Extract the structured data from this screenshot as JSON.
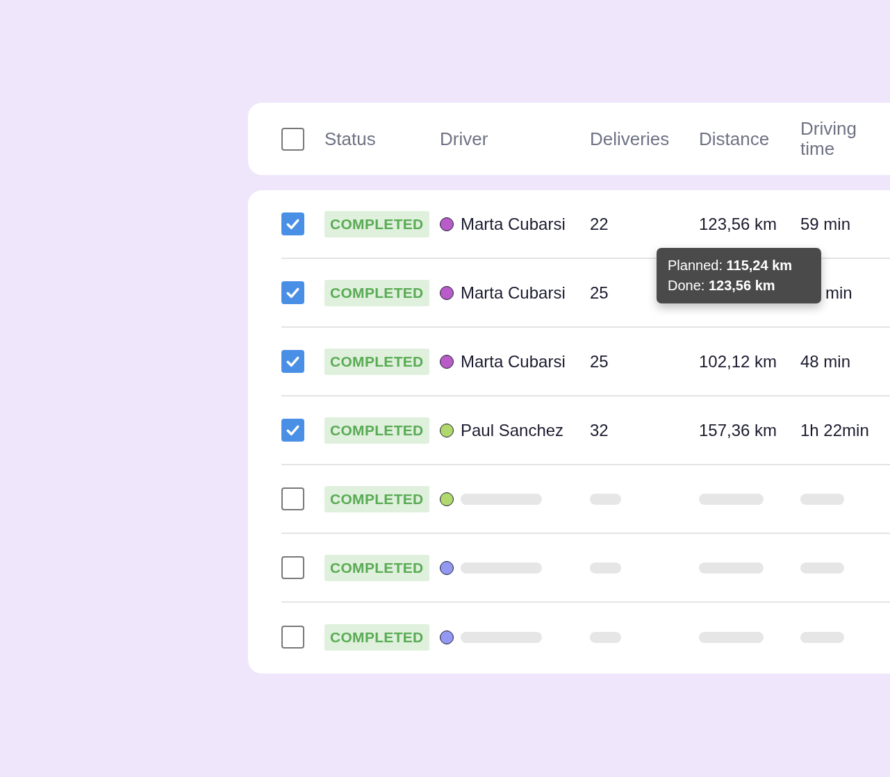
{
  "header": {
    "checked": false,
    "columns": [
      "Status",
      "Driver",
      "Deliveries",
      "Distance",
      "Driving time"
    ]
  },
  "rows": [
    {
      "kind": "data",
      "checked": true,
      "status": "COMPLETED",
      "color": "#b85cc8",
      "driver": "Marta Cubarsi",
      "deliveries": "22",
      "distance": "123,56 km",
      "driving_time": "59 min"
    },
    {
      "kind": "data",
      "checked": true,
      "status": "COMPLETED",
      "color": "#b85cc8",
      "driver": "Marta Cubarsi",
      "deliveries": "25",
      "driving_time": "min",
      "covered": true
    },
    {
      "kind": "data",
      "checked": true,
      "status": "COMPLETED",
      "color": "#b85cc8",
      "driver": "Marta Cubarsi",
      "deliveries": "25",
      "distance": "102,12 km",
      "driving_time": "48 min"
    },
    {
      "kind": "data",
      "checked": true,
      "status": "COMPLETED",
      "color": "#b0d86c",
      "driver": "Paul Sanchez",
      "deliveries": "32",
      "distance": "157,36 km",
      "driving_time": "1h 22min"
    },
    {
      "kind": "placeholder",
      "checked": false,
      "status": "COMPLETED",
      "color": "#b0d86c"
    },
    {
      "kind": "placeholder",
      "checked": false,
      "status": "COMPLETED",
      "color": "#9399f0"
    },
    {
      "kind": "placeholder",
      "checked": false,
      "status": "COMPLETED",
      "color": "#9399f0"
    }
  ],
  "tooltip": {
    "lines": [
      "Planned: **115,24 km**",
      "Done: **123,56 km**"
    ]
  }
}
